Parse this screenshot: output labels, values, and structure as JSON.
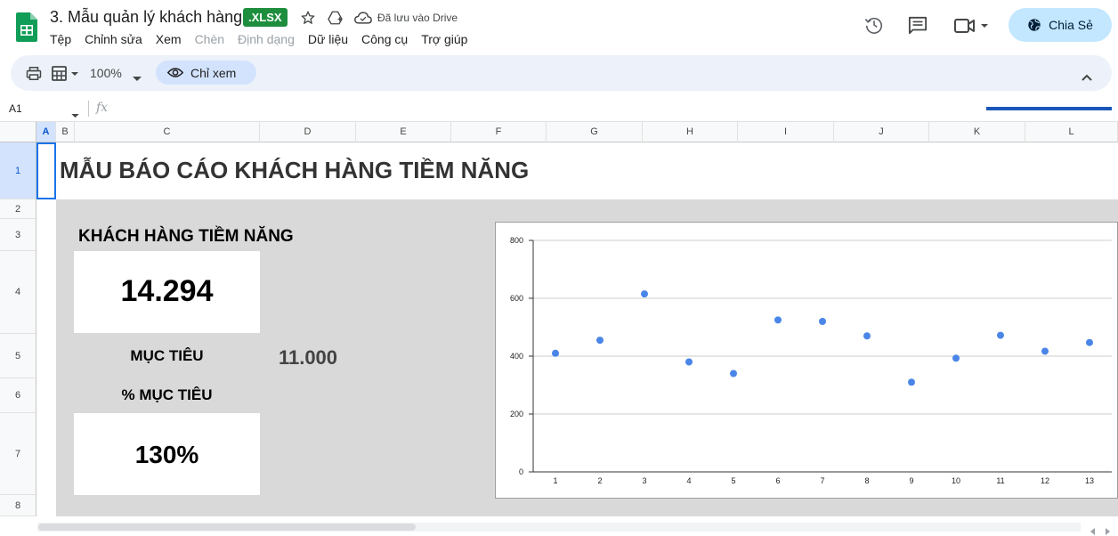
{
  "doc": {
    "title": "3. Mẫu quản lý khách hàng",
    "badge": ".XLSX",
    "saved_status": "Đã lưu vào Drive"
  },
  "menu": [
    "Tệp",
    "Chỉnh sửa",
    "Xem",
    "Chèn",
    "Định dạng",
    "Dữ liệu",
    "Công cụ",
    "Trợ giúp"
  ],
  "menu_disabled": [
    false,
    false,
    false,
    true,
    true,
    false,
    false,
    false
  ],
  "share": {
    "label": "Chia Sẻ"
  },
  "toolbar": {
    "zoom": "100%",
    "view_mode": "Chỉ xem"
  },
  "formula": {
    "name_box": "A1",
    "fx": "fx"
  },
  "columns": [
    "A",
    "B",
    "C",
    "D",
    "E",
    "F",
    "G",
    "H",
    "I",
    "J",
    "K",
    "L"
  ],
  "rows": [
    "1",
    "2",
    "3",
    "4",
    "5",
    "6",
    "7",
    "8"
  ],
  "sheet": {
    "report_title": "MẪU BÁO CÁO KHÁCH HÀNG TIỀM NĂNG",
    "kpi_heading": "KHÁCH HÀNG TIỀM NĂNG",
    "kpi_value": "14.294",
    "target_label": "MỤC TIÊU",
    "target_value": "11.000",
    "percent_label": "% MỤC TIÊU",
    "percent_value": "130%"
  },
  "chart_data": {
    "type": "scatter",
    "x": [
      1,
      2,
      3,
      4,
      5,
      6,
      7,
      8,
      9,
      10,
      11,
      12,
      13
    ],
    "y": [
      410,
      455,
      615,
      380,
      340,
      525,
      520,
      470,
      310,
      393,
      472,
      417,
      447
    ],
    "xlim": [
      0.5,
      13.5
    ],
    "ylim": [
      0,
      800
    ],
    "yticks": [
      0,
      200,
      400,
      600,
      800
    ],
    "grid": true,
    "color": "#4a86e8",
    "title": "",
    "xlabel": "",
    "ylabel": ""
  }
}
